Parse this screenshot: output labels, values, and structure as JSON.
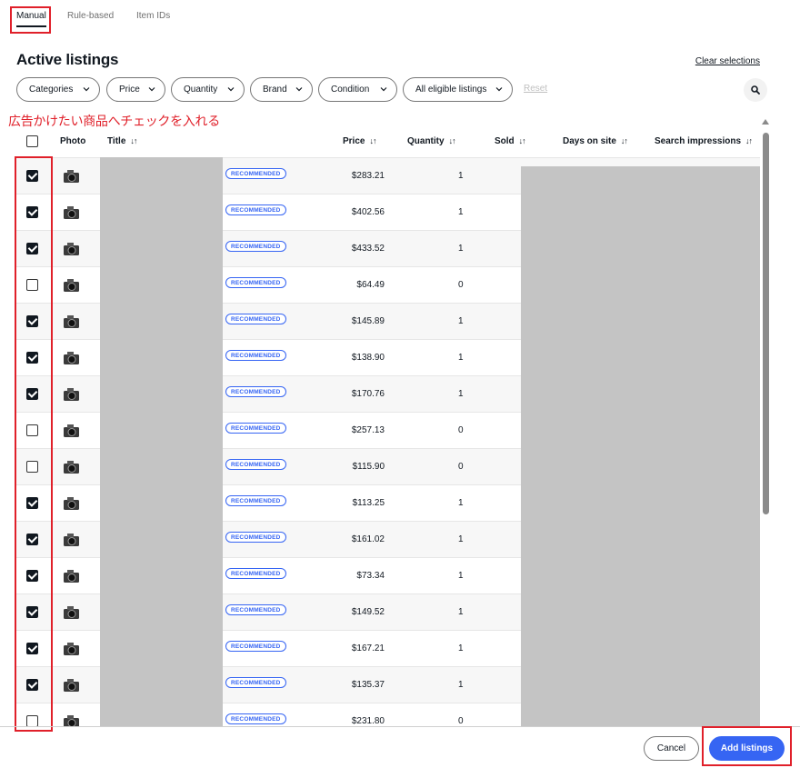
{
  "tabs": [
    {
      "label": "Manual",
      "active": true
    },
    {
      "label": "Rule-based",
      "active": false
    },
    {
      "label": "Item IDs",
      "active": false
    }
  ],
  "page_title": "Active listings",
  "clear_selections": "Clear selections",
  "filters": [
    "Categories",
    "Price",
    "Quantity",
    "Brand",
    "Condition",
    "All eligible listings"
  ],
  "reset_label": "Reset",
  "search_icon": "search-icon",
  "annotation": "広告かけたい商品へチェックを入れる",
  "columns": {
    "photo": "Photo",
    "title": "Title",
    "price": "Price",
    "quantity": "Quantity",
    "sold": "Sold",
    "days_on_site": "Days on site",
    "search_impressions": "Search impressions"
  },
  "badge_label": "RECOMMENDED",
  "rows": [
    {
      "checked": true,
      "price": "$283.21",
      "quantity": "1"
    },
    {
      "checked": true,
      "price": "$402.56",
      "quantity": "1"
    },
    {
      "checked": true,
      "price": "$433.52",
      "quantity": "1"
    },
    {
      "checked": false,
      "price": "$64.49",
      "quantity": "0"
    },
    {
      "checked": true,
      "price": "$145.89",
      "quantity": "1"
    },
    {
      "checked": true,
      "price": "$138.90",
      "quantity": "1"
    },
    {
      "checked": true,
      "price": "$170.76",
      "quantity": "1"
    },
    {
      "checked": false,
      "price": "$257.13",
      "quantity": "0"
    },
    {
      "checked": false,
      "price": "$115.90",
      "quantity": "0"
    },
    {
      "checked": true,
      "price": "$113.25",
      "quantity": "1"
    },
    {
      "checked": true,
      "price": "$161.02",
      "quantity": "1"
    },
    {
      "checked": true,
      "price": "$73.34",
      "quantity": "1"
    },
    {
      "checked": true,
      "price": "$149.52",
      "quantity": "1"
    },
    {
      "checked": true,
      "price": "$167.21",
      "quantity": "1"
    },
    {
      "checked": true,
      "price": "$135.37",
      "quantity": "1"
    },
    {
      "checked": false,
      "price": "$231.80",
      "quantity": "0"
    }
  ],
  "footer": {
    "cancel": "Cancel",
    "add": "Add listings"
  },
  "colors": {
    "accent": "#3665f3",
    "annotation_red": "#e0202a",
    "redaction": "#c4c4c4"
  }
}
